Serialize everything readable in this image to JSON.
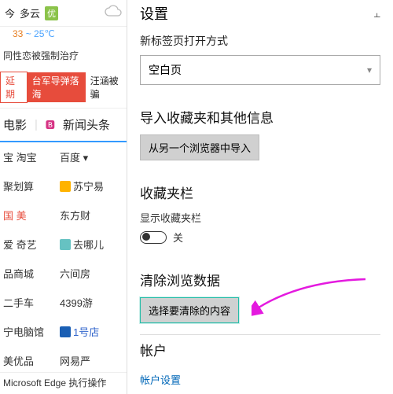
{
  "weather": {
    "today": "今",
    "cond": "多云",
    "air": "优",
    "temp_hi": "33",
    "temp_lo": "~ 25℃"
  },
  "news_line": "同性恋被强制治疗",
  "news_tags": {
    "t1": "延期",
    "t2": "台军导弹落海",
    "t3": "汪涵被骗"
  },
  "tabs": {
    "movie": "电影",
    "sep": "|",
    "news": "新闻头条",
    "news_icon": "🅱"
  },
  "leftlinks": {
    "r1": {
      "a": "宝 淘宝",
      "b": "百度 ▾"
    },
    "r2": {
      "a": "聚划算",
      "b": "苏宁易"
    },
    "r3": {
      "a": "国 美",
      "b": "东方财"
    },
    "r4": {
      "a": "爱 奇艺",
      "b": "去哪儿"
    },
    "r5": {
      "a": "品商城",
      "b": "六间房"
    },
    "r6": {
      "a": "二手车",
      "b": "4399游"
    },
    "r7": {
      "a": "宁电脑馆",
      "b": "1号店"
    },
    "r8": {
      "a": "美优品",
      "b": "网易严"
    }
  },
  "edge_bar": {
    "label": "Microsoft Edge 执行操作"
  },
  "settings": {
    "title": "设置",
    "new_tab_label": "新标签页打开方式",
    "new_tab_value": "空白页",
    "import_title": "导入收藏夹和其他信息",
    "import_btn": "从另一个浏览器中导入",
    "fav_title": "收藏夹栏",
    "fav_show": "显示收藏夹栏",
    "toggle_off": "关",
    "clear_title": "清除浏览数据",
    "clear_btn": "选择要清除的内容",
    "account_title": "帐户",
    "account_link": "帐户设置"
  }
}
